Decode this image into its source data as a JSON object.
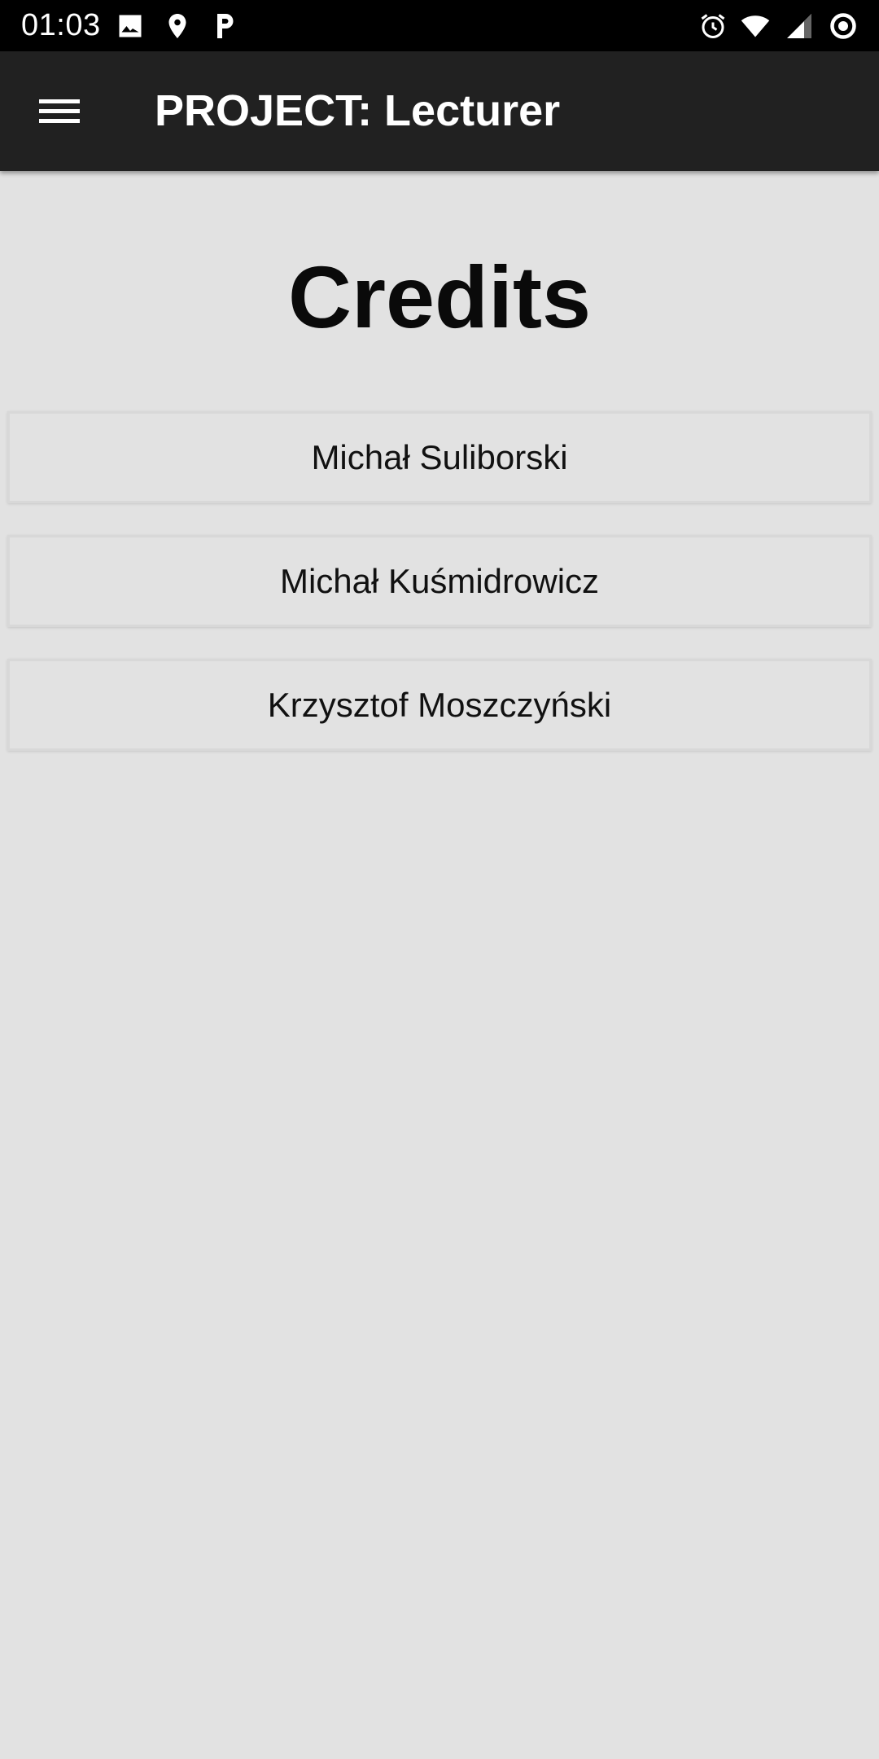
{
  "status_bar": {
    "time": "01:03",
    "left_icons": [
      "image-icon",
      "location-pin-icon",
      "parking-app-icon"
    ],
    "right_icons": [
      "alarm-icon",
      "wifi-icon",
      "cell-signal-icon",
      "sync-circle-icon"
    ]
  },
  "app_bar": {
    "menu_icon": "hamburger-menu-icon",
    "title": "PROJECT: Lecturer",
    "background": "#212121"
  },
  "main": {
    "title": "Credits",
    "credits": [
      {
        "name": "Michał Suliborski"
      },
      {
        "name": "Michał Kuśmidrowicz"
      },
      {
        "name": "Krzysztof Moszczyński"
      }
    ]
  },
  "colors": {
    "page_background": "#e2e2e2",
    "status_bar": "#000000",
    "text": "#111111"
  }
}
